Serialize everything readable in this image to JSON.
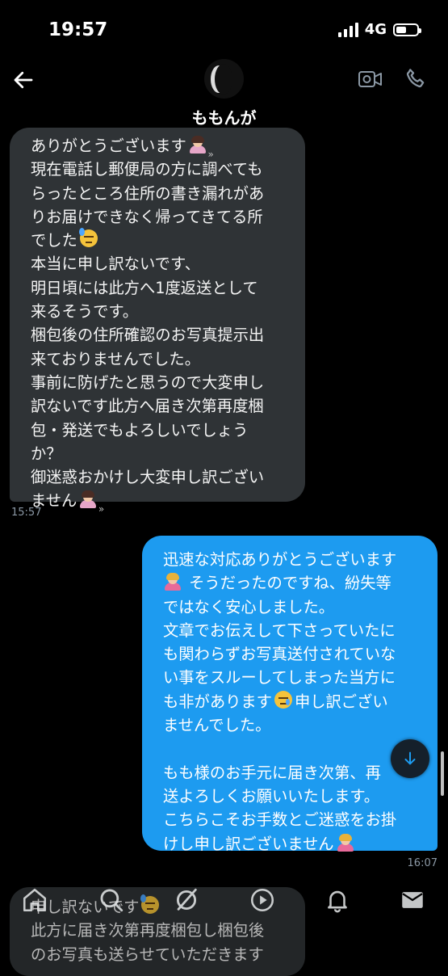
{
  "status_bar": {
    "time": "19:57",
    "network": "4G"
  },
  "header": {
    "contact_name": "ももんが"
  },
  "messages": {
    "received_1": {
      "lines": [
        "ありがとうございます",
        "現在電話し郵便局の方に調べても",
        "らったところ住所の書き漏れがあ",
        "りお届けできなく帰ってきてる所",
        "でした",
        "本当に申し訳ないです、",
        "明日頃には此方へ1度返送として",
        "来るそうです。",
        "梱包後の住所確認のお写真提示出",
        "来ておりませんでした。",
        "事前に防げたと思うので大変申し",
        "訳ないです此方へ届き次第再度梱",
        "包・発送でもよろしいでしょう",
        "か？",
        "御迷惑おかけし大変申し訳ござい",
        "ません"
      ],
      "time": "15:57"
    },
    "sent_1": {
      "lines": [
        "迅速な対応ありがとうございます",
        "そうだったのですね、紛失等",
        "ではなく安心しました。",
        "文章でお伝えして下さっていたに",
        "も関わらずお写真送付されていな",
        "い事をスルーしてしまった当方に",
        "も非があります",
        "申し訳ござい",
        "ませんでした。",
        "",
        "もも様のお手元に届き次第、再",
        "送よろしくお願いいたします。",
        "こちらこそお手数とご迷惑をお掛",
        "けし申し訳ございません"
      ],
      "time": "16:07"
    },
    "received_2": {
      "lines": [
        "申し訳ないです",
        "此方に届き次第再度梱包し梱包後",
        "のお写真も送らせていただきます"
      ]
    }
  },
  "icons": {
    "back": "arrow-left-icon",
    "video": "video-camera-icon",
    "phone": "phone-icon",
    "scroll_down": "arrow-down-icon",
    "tabs": [
      "home-icon",
      "search-icon",
      "grok-icon",
      "video-play-icon",
      "bell-icon",
      "mail-icon"
    ]
  },
  "colors": {
    "sent_bubble": "#1d9bf0",
    "received_bubble": "#2f3336",
    "background": "#000000"
  }
}
